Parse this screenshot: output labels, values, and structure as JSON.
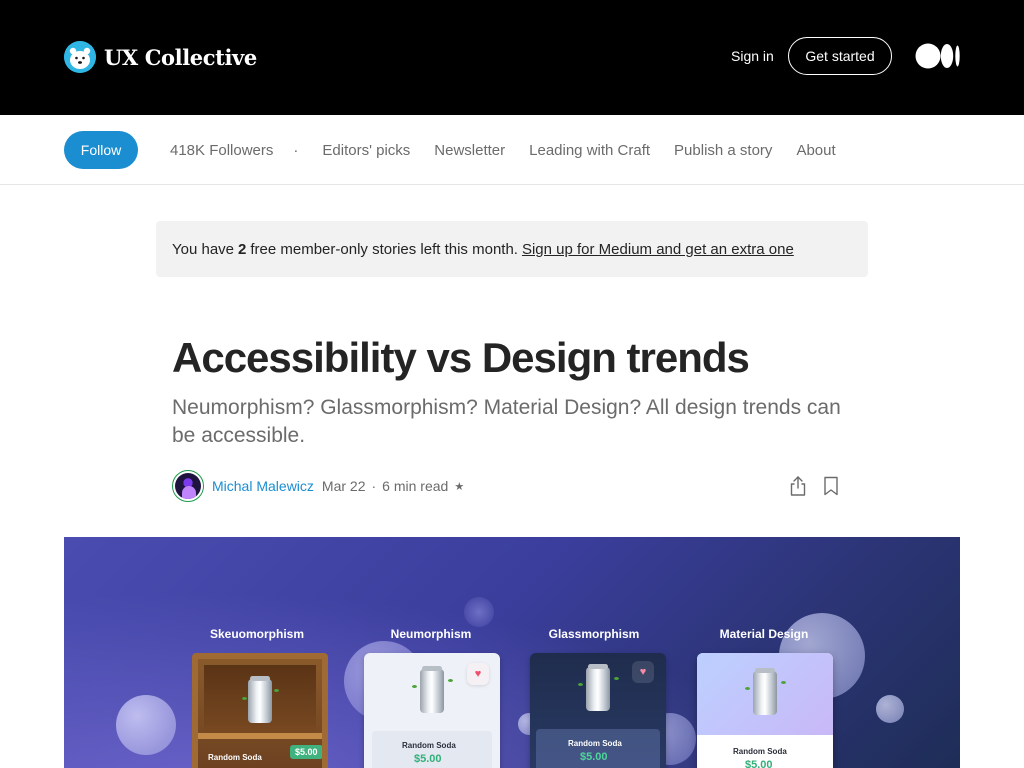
{
  "header": {
    "brand_name": "UX Collective",
    "sign_in": "Sign in",
    "get_started": "Get started",
    "brand_icon": "polar-bear-logo-icon",
    "medium_icon": "medium-logo-icon"
  },
  "publication_nav": {
    "follow": "Follow",
    "followers": "418K Followers",
    "dot": "·",
    "items": [
      "Editors' picks",
      "Newsletter",
      "Leading with Craft",
      "Publish a story",
      "About"
    ]
  },
  "member_banner": {
    "prefix": "You have",
    "count": "2",
    "suffix": "free member-only stories left this month.",
    "link": "Sign up for Medium and get an extra one"
  },
  "article": {
    "title": "Accessibility vs Design trends",
    "subtitle": "Neumorphism? Glassmorphism? Material Design? All design trends can be accessible.",
    "author": "Michal Malewicz",
    "date": "Mar 22",
    "separator": "·",
    "read_time": "6 min read",
    "member_star": "★",
    "share_icon": "share-icon",
    "bookmark_icon": "bookmark-icon"
  },
  "hero": {
    "cards": [
      {
        "label": "Skeuomorphism",
        "name": "Random Soda",
        "price": "$5.00"
      },
      {
        "label": "Neumorphism",
        "name": "Random Soda",
        "price": "$5.00"
      },
      {
        "label": "Glassmorphism",
        "name": "Random Soda",
        "price": "$5.00"
      },
      {
        "label": "Material Design",
        "name": "Random Soda",
        "price": "$5.00"
      }
    ],
    "heart_glyph": "♥"
  },
  "colors": {
    "accent": "#1a8ed1",
    "header_bg": "#000000",
    "text": "#242424",
    "muted": "#6b6b6b"
  }
}
